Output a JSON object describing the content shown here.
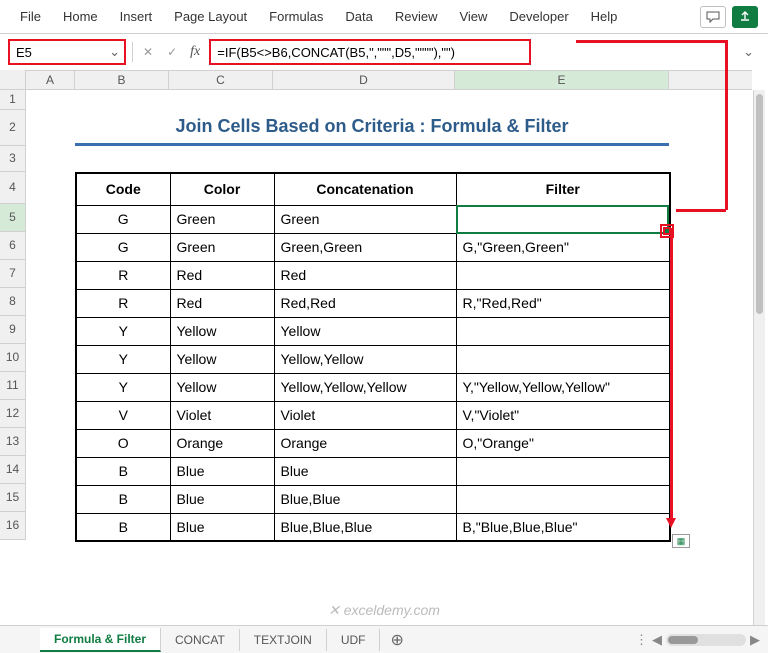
{
  "ribbon": {
    "tabs": [
      "File",
      "Home",
      "Insert",
      "Page Layout",
      "Formulas",
      "Data",
      "Review",
      "View",
      "Developer",
      "Help"
    ]
  },
  "nameBox": "E5",
  "formula": "=IF(B5<>B6,CONCAT(B5,\",\"\"\",D5,\"\"\"\"),\"\")",
  "colHeaders": [
    "A",
    "B",
    "C",
    "D",
    "E"
  ],
  "rowHeaders": [
    "1",
    "2",
    "3",
    "4",
    "5",
    "6",
    "7",
    "8",
    "9",
    "10",
    "11",
    "12",
    "13",
    "14",
    "15",
    "16"
  ],
  "title": "Join Cells Based on Criteria : Formula & Filter",
  "headers": {
    "b": "Code",
    "c": "Color",
    "d": "Concatenation",
    "e": "Filter"
  },
  "rows": [
    {
      "b": "G",
      "c": "Green",
      "d": "Green",
      "e": ""
    },
    {
      "b": "G",
      "c": "Green",
      "d": "Green,Green",
      "e": "G,\"Green,Green\""
    },
    {
      "b": "R",
      "c": "Red",
      "d": "Red",
      "e": ""
    },
    {
      "b": "R",
      "c": "Red",
      "d": "Red,Red",
      "e": "R,\"Red,Red\""
    },
    {
      "b": "Y",
      "c": "Yellow",
      "d": "Yellow",
      "e": ""
    },
    {
      "b": "Y",
      "c": "Yellow",
      "d": "Yellow,Yellow",
      "e": ""
    },
    {
      "b": "Y",
      "c": "Yellow",
      "d": "Yellow,Yellow,Yellow",
      "e": "Y,\"Yellow,Yellow,Yellow\""
    },
    {
      "b": "V",
      "c": "Violet",
      "d": "Violet",
      "e": "V,\"Violet\""
    },
    {
      "b": "O",
      "c": "Orange",
      "d": "Orange",
      "e": "O,\"Orange\""
    },
    {
      "b": "B",
      "c": "Blue",
      "d": "Blue",
      "e": ""
    },
    {
      "b": "B",
      "c": "Blue",
      "d": "Blue,Blue",
      "e": ""
    },
    {
      "b": "B",
      "c": "Blue",
      "d": "Blue,Blue,Blue",
      "e": "B,\"Blue,Blue,Blue\""
    }
  ],
  "sheets": [
    "Formula & Filter",
    "CONCAT",
    "TEXTJOIN",
    "UDF"
  ],
  "watermark": "✕ exceldemy.com"
}
